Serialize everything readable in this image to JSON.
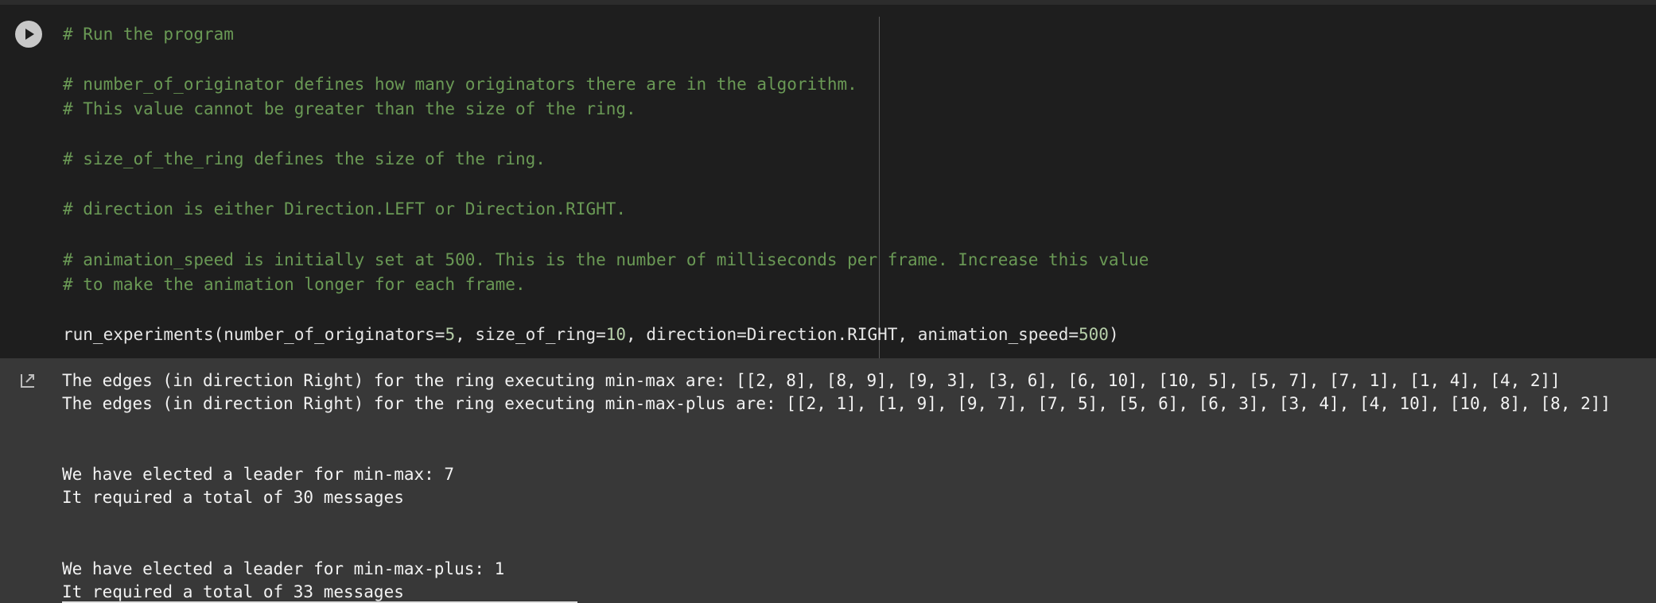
{
  "code_cell": {
    "run_button_label": "Run cell",
    "lines": [
      "# Run the program",
      "# number_of_originator defines how many originators there are in the algorithm.",
      "# This value cannot be greater than the size of the ring.",
      "# size_of_the_ring defines the size of the ring.",
      "# direction is either Direction.LEFT or Direction.RIGHT.",
      "# animation_speed is initially set at 500. This is the number of milliseconds per frame. Increase this value",
      "# to make the animation longer for each frame."
    ],
    "call": {
      "prefix": "run_experiments(number_of_originators=",
      "arg1": "5",
      "mid1": ", size_of_ring=",
      "arg2": "10",
      "mid2": ", direction=Direction.RIGHT, animation_speed=",
      "arg3": "500",
      "suffix": ")"
    }
  },
  "output": {
    "icon": "output-redirect-icon",
    "lines": [
      "The edges (in direction Right) for the ring executing min-max are: [[2, 8], [8, 9], [9, 3], [3, 6], [6, 10], [10, 5], [5, 7], [7, 1], [1, 4], [4, 2]]",
      "The edges (in direction Right) for the ring executing min-max-plus are: [[2, 1], [1, 9], [9, 7], [7, 5], [5, 6], [6, 3], [3, 4], [4, 10], [10, 8], [8, 2]]",
      "We have elected a leader for min-max: 7",
      "It required a total of 30 messages",
      "We have elected a leader for min-max-plus: 1",
      "It required a total of 33 messages"
    ]
  },
  "colors": {
    "comment": "#6a9955",
    "code_background": "#1e1e1e",
    "output_background": "#383838",
    "number": "#b5cea8"
  }
}
